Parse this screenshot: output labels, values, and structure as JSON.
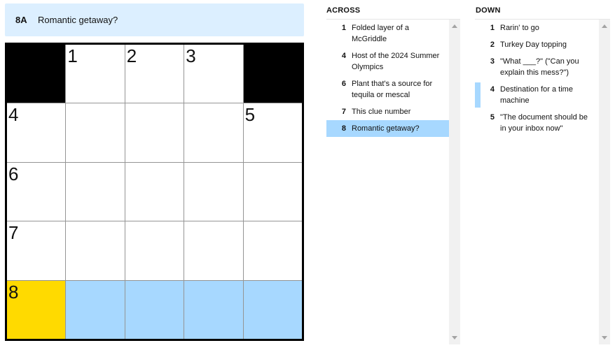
{
  "current_clue": {
    "number": "8A",
    "text": "Romantic getaway?"
  },
  "grid": {
    "rows": [
      [
        {
          "type": "block"
        },
        {
          "type": "cell",
          "label": "1"
        },
        {
          "type": "cell",
          "label": "2"
        },
        {
          "type": "cell",
          "label": "3"
        },
        {
          "type": "block"
        }
      ],
      [
        {
          "type": "cell",
          "label": "4"
        },
        {
          "type": "cell"
        },
        {
          "type": "cell"
        },
        {
          "type": "cell"
        },
        {
          "type": "cell",
          "label": "5"
        }
      ],
      [
        {
          "type": "cell",
          "label": "6"
        },
        {
          "type": "cell"
        },
        {
          "type": "cell"
        },
        {
          "type": "cell"
        },
        {
          "type": "cell"
        }
      ],
      [
        {
          "type": "cell",
          "label": "7"
        },
        {
          "type": "cell"
        },
        {
          "type": "cell"
        },
        {
          "type": "cell"
        },
        {
          "type": "cell"
        }
      ],
      [
        {
          "type": "cell",
          "label": "8",
          "state": "selected"
        },
        {
          "type": "cell",
          "state": "highlight"
        },
        {
          "type": "cell",
          "state": "highlight"
        },
        {
          "type": "cell",
          "state": "highlight"
        },
        {
          "type": "cell",
          "state": "highlight"
        }
      ]
    ]
  },
  "across": {
    "title": "ACROSS",
    "clues": [
      {
        "num": "1",
        "text": "Folded layer of a McGriddle"
      },
      {
        "num": "4",
        "text": "Host of the 2024 Summer Olympics"
      },
      {
        "num": "6",
        "text": "Plant that's a source for tequila or mescal"
      },
      {
        "num": "7",
        "text": "This clue number"
      },
      {
        "num": "8",
        "text": "Romantic getaway?",
        "active": true
      }
    ]
  },
  "down": {
    "title": "DOWN",
    "clues": [
      {
        "num": "1",
        "text": "Rarin' to go"
      },
      {
        "num": "2",
        "text": "Turkey Day topping"
      },
      {
        "num": "3",
        "text": "\"What ___?\" (\"Can you explain this mess?\")"
      },
      {
        "num": "4",
        "text": "Destination for a time machine",
        "crossing": true
      },
      {
        "num": "5",
        "text": "\"The document should be in your inbox now\""
      }
    ]
  },
  "colors": {
    "selected": "#ffda00",
    "highlight": "#a7d8ff",
    "clue_bar": "#dcefff"
  }
}
